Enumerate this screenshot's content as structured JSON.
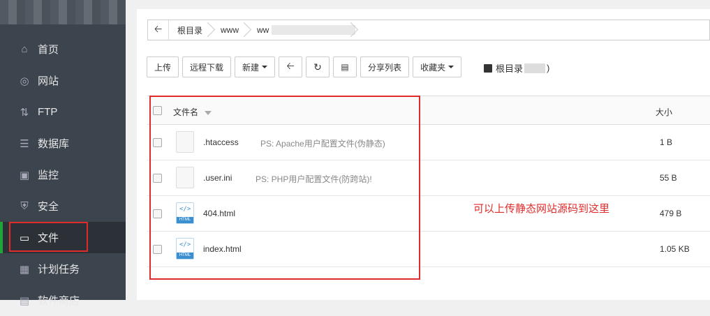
{
  "sidebar": {
    "items": [
      {
        "label": "首页",
        "icon": "home-icon"
      },
      {
        "label": "网站",
        "icon": "globe-icon"
      },
      {
        "label": "FTP",
        "icon": "ftp-icon"
      },
      {
        "label": "数据库",
        "icon": "database-icon"
      },
      {
        "label": "监控",
        "icon": "monitor-icon"
      },
      {
        "label": "安全",
        "icon": "shield-icon"
      },
      {
        "label": "文件",
        "icon": "folder-icon",
        "active": true
      },
      {
        "label": "计划任务",
        "icon": "calendar-icon"
      },
      {
        "label": "软件商店",
        "icon": "store-icon"
      }
    ]
  },
  "breadcrumb": {
    "root": "根目录",
    "seg1": "www",
    "seg2": "ww"
  },
  "toolbar": {
    "upload": "上传",
    "remote_download": "远程下载",
    "new": "新建",
    "share_list": "分享列表",
    "favorites": "收藏夹",
    "disk_label": "根目录",
    "disk_close": ")"
  },
  "table": {
    "header_name": "文件名",
    "header_size": "大小",
    "rows": [
      {
        "name": ".htaccess",
        "note": "PS: Apache用户配置文件(伪静态)",
        "size": "1 B",
        "type": "file"
      },
      {
        "name": ".user.ini",
        "note": "PS: PHP用户配置文件(防跨站)!",
        "size": "55 B",
        "type": "file"
      },
      {
        "name": "404.html",
        "note": "",
        "size": "479 B",
        "type": "html"
      },
      {
        "name": "index.html",
        "note": "",
        "size": "1.05 KB",
        "type": "html"
      }
    ]
  },
  "html_icon_code": "</>",
  "html_icon_tag": "HTML",
  "annotation": "可以上传静态网站源码到这里",
  "colors": {
    "accent": "#20a53a",
    "highlight": "#e02b2b",
    "sidebar": "#3c444d"
  }
}
